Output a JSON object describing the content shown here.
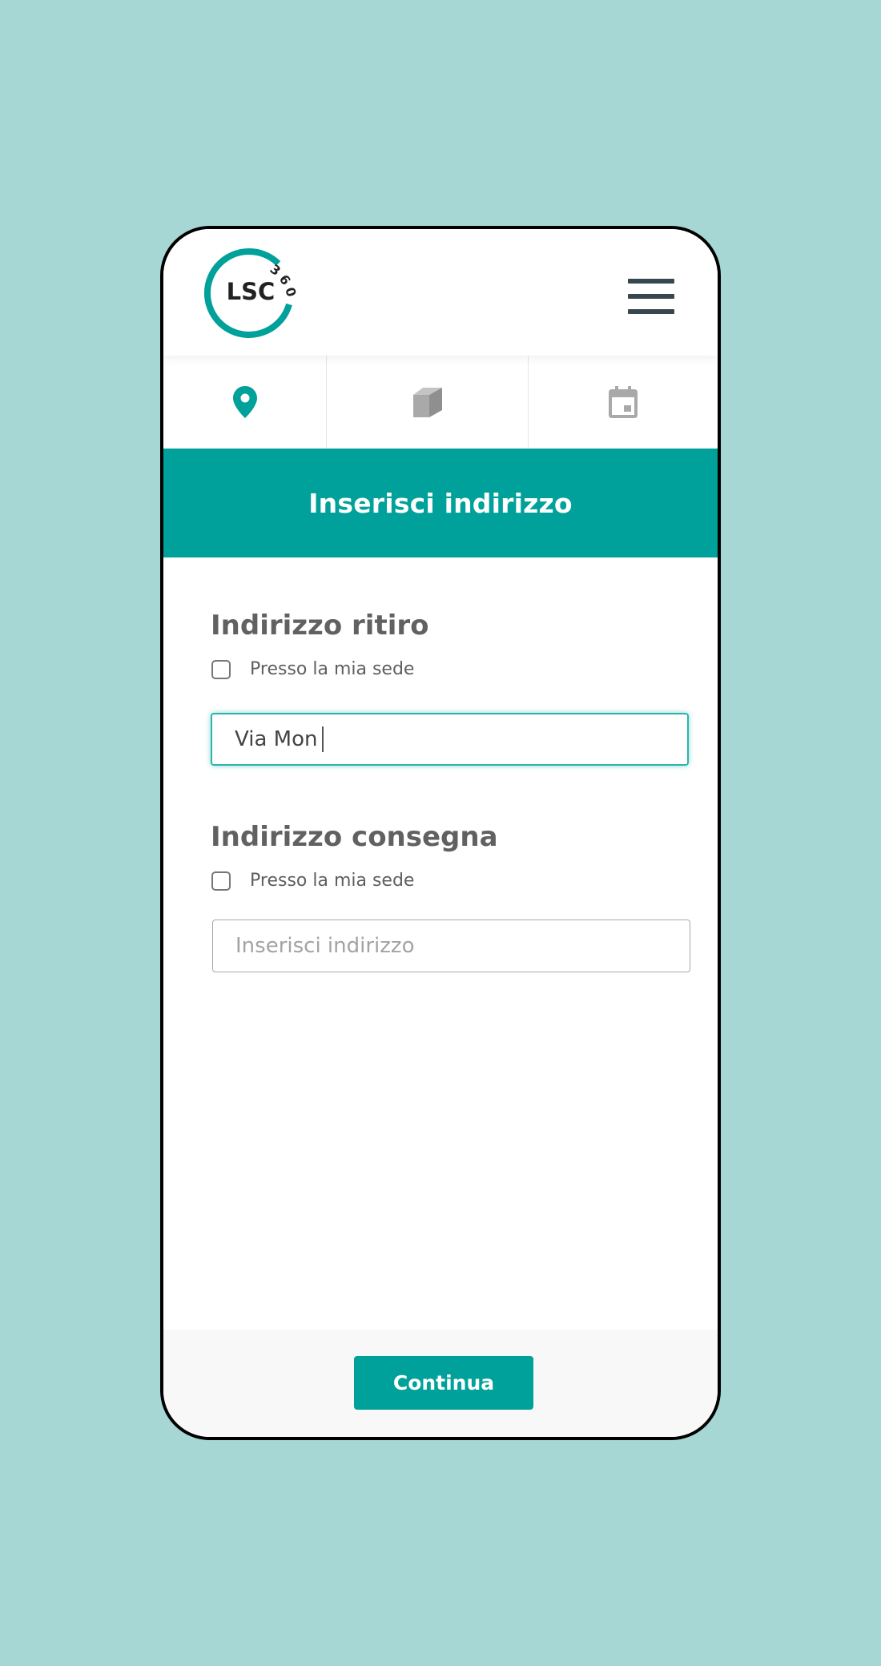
{
  "brand": {
    "logo_text": "LSC",
    "logo_badge": "360",
    "accent_color": "#00a19a"
  },
  "header": {
    "menu_icon": "hamburger-menu-icon"
  },
  "steps": [
    {
      "icon": "map-pin-icon",
      "active": true
    },
    {
      "icon": "package-box-icon",
      "active": false
    },
    {
      "icon": "calendar-icon",
      "active": false
    }
  ],
  "banner": {
    "title": "Inserisci indirizzo"
  },
  "pickup": {
    "title": "Indirizzo ritiro",
    "checkbox_label": "Presso la mia sede",
    "input_value": "Via Mon"
  },
  "delivery": {
    "title": "Indirizzo consegna",
    "checkbox_label": "Presso la mia sede",
    "input_placeholder": "Inserisci indirizzo"
  },
  "footer": {
    "continue_label": "Continua"
  }
}
